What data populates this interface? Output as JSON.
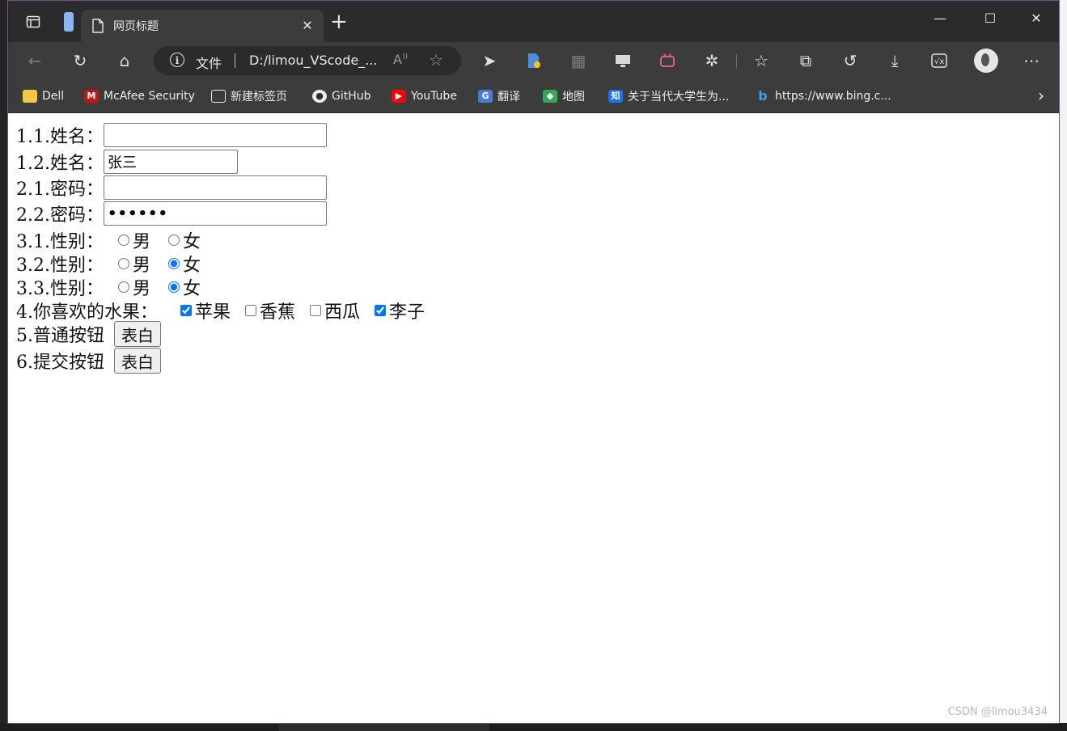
{
  "browser": {
    "tab_title": "网页标题",
    "url_scheme": "文件",
    "url": "D:/limou_VScode_...",
    "favorites": [
      {
        "label": "Dell",
        "icon": "folder-icon"
      },
      {
        "label": "McAfee Security",
        "icon": "mcafee-icon"
      },
      {
        "label": "新建标签页",
        "icon": "newtab-icon"
      },
      {
        "label": "GitHub",
        "icon": "github-icon"
      },
      {
        "label": "YouTube",
        "icon": "youtube-icon"
      },
      {
        "label": "翻译",
        "icon": "translate-icon"
      },
      {
        "label": "地图",
        "icon": "maps-icon"
      },
      {
        "label": "关于当代大学生为...",
        "icon": "zhihu-icon"
      },
      {
        "label": "https://www.bing.c...",
        "icon": "bing-icon"
      }
    ]
  },
  "form": {
    "name1_label": "1.1.姓名：",
    "name1_value": "",
    "name2_label": "1.2.姓名：",
    "name2_value": "张三",
    "pwd1_label": "2.1.密码：",
    "pwd1_value": "",
    "pwd2_label": "2.2.密码：",
    "pwd2_value": "••••••",
    "gender1_label": "3.1.性别：",
    "gender2_label": "3.2.性别：",
    "gender3_label": "3.3.性别：",
    "male": "男",
    "female": "女",
    "gender1_selected": "none",
    "gender2_selected": "女",
    "gender3_selected": "女",
    "fruit_label": "4.你喜欢的水果：",
    "fruits": [
      {
        "label": "苹果",
        "checked": true
      },
      {
        "label": "香蕉",
        "checked": false
      },
      {
        "label": "西瓜",
        "checked": false
      },
      {
        "label": "李子",
        "checked": true
      }
    ],
    "button1_label": "5.普通按钮",
    "button1_text": "表白",
    "button2_label": "6.提交按钮",
    "button2_text": "表白"
  },
  "watermark": "CSDN @limou3434"
}
